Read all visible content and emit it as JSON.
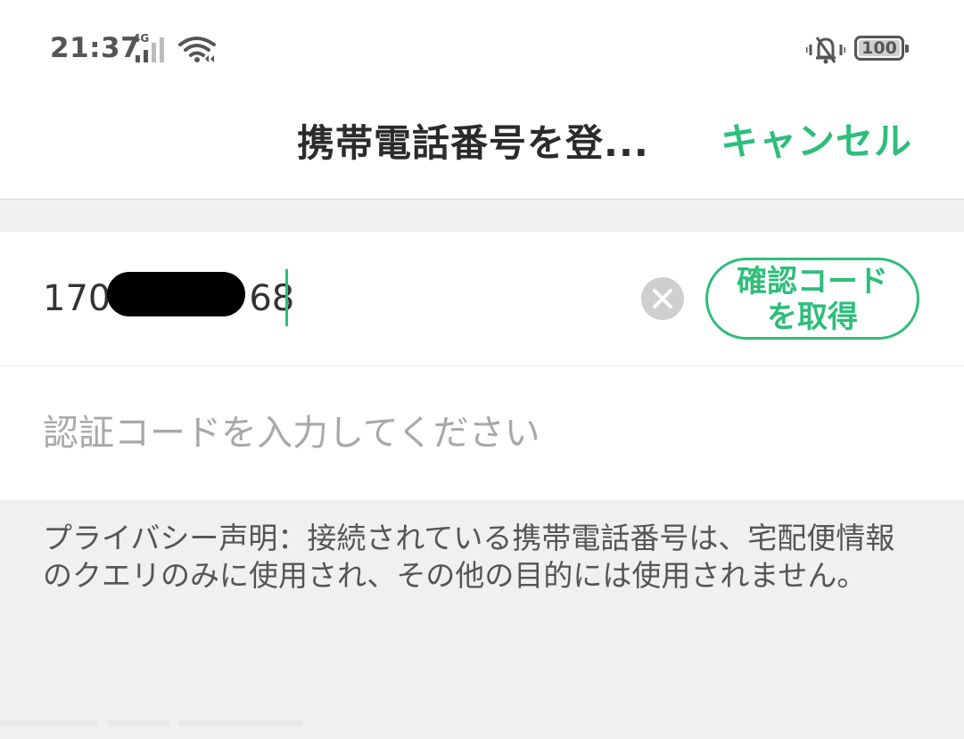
{
  "status_bar": {
    "time": "21:37",
    "network": "4G",
    "battery": "100"
  },
  "nav": {
    "title": "携帯電話番号を登...",
    "cancel_label": "キャンセル"
  },
  "phone_row": {
    "value_prefix": "170",
    "value_suffix": "68",
    "get_code_label_line1": "確認コード",
    "get_code_label_line2": "を取得"
  },
  "code_row": {
    "placeholder": "認証コードを入力してください",
    "value": ""
  },
  "privacy": {
    "text": "プライバシー声明：接続されている携帯電話番号は、宅配便情報のクエリのみに使用され、その他の目的には使用されません。"
  },
  "colors": {
    "accent": "#2dbe7a",
    "background": "#f0f0f0",
    "surface": "#ffffff"
  },
  "icons": [
    "signal-icon",
    "wifi-icon",
    "bell-vibrate-icon",
    "battery-icon",
    "clear-icon"
  ]
}
